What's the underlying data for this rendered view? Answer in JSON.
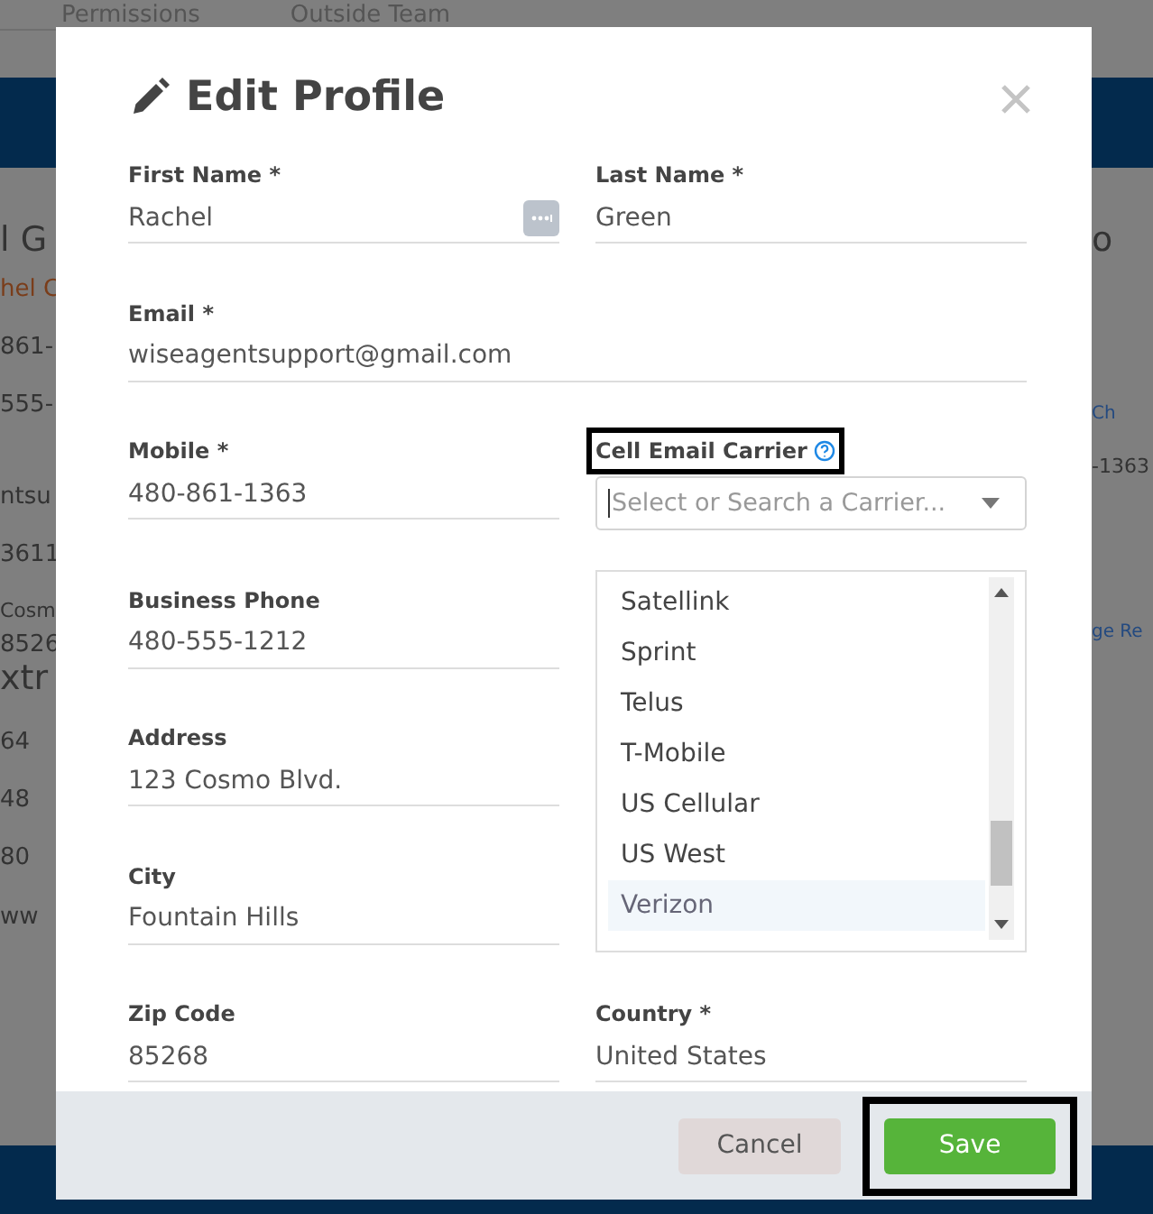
{
  "background": {
    "tabs": [
      {
        "label": "Permissions"
      },
      {
        "label": "Outside Team"
      }
    ],
    "left_fragments": [
      {
        "text": "l G",
        "kind": "heading"
      },
      {
        "text": "hel C",
        "kind": "accent"
      },
      {
        "text": "861-",
        "kind": "text"
      },
      {
        "text": "555-",
        "kind": "text"
      },
      {
        "text": "ntsu",
        "kind": "gap"
      },
      {
        "text": "3611",
        "kind": "text"
      },
      {
        "text": "Cosm",
        "kind": "small"
      },
      {
        "text": "8526",
        "kind": "tight"
      },
      {
        "text": "xtr",
        "kind": "heading"
      },
      {
        "text": "64",
        "kind": "text"
      },
      {
        "text": "48",
        "kind": "text"
      },
      {
        "text": "80",
        "kind": "text"
      },
      {
        "text": "ww",
        "kind": "text"
      }
    ],
    "right_fragments": [
      {
        "text": "o",
        "kind": "heading"
      },
      {
        "text": "Ch",
        "kind": "link"
      },
      {
        "text": "-1363",
        "kind": "small"
      },
      {
        "text": "ge Re",
        "kind": "link"
      }
    ]
  },
  "dialog": {
    "title": "Edit Profile",
    "fields": [
      {
        "kind": "text",
        "label": "First Name *",
        "value": "Rachel",
        "autofill_icon": true
      },
      {
        "kind": "text",
        "label": "Last Name *",
        "value": "Green"
      },
      {
        "kind": "wide",
        "label": "Email *",
        "value": "wiseagentsupport@gmail.com"
      },
      {
        "kind": "text",
        "label": "Mobile *",
        "value": "480-861-1363"
      },
      {
        "kind": "select",
        "label": "Cell Email Carrier",
        "highlighted": true,
        "placeholder": "Select or Search a Carrier...",
        "expanded": true,
        "options": [
          {
            "label": "Satellink",
            "selected": false
          },
          {
            "label": "Sprint",
            "selected": false
          },
          {
            "label": "Telus",
            "selected": false
          },
          {
            "label": "T-Mobile",
            "selected": false
          },
          {
            "label": "US Cellular",
            "selected": false
          },
          {
            "label": "US West",
            "selected": false
          },
          {
            "label": "Verizon",
            "selected": true
          }
        ]
      },
      {
        "kind": "text",
        "label": "Business Phone",
        "value": "480-555-1212"
      },
      {
        "kind": "blank"
      },
      {
        "kind": "text",
        "label": "Address",
        "value": "123 Cosmo Blvd."
      },
      {
        "kind": "blank"
      },
      {
        "kind": "text",
        "label": "City",
        "value": "Fountain Hills"
      },
      {
        "kind": "blank"
      },
      {
        "kind": "text",
        "label": "Zip Code",
        "value": "85268"
      },
      {
        "kind": "text",
        "label": "Country *",
        "value": "United States"
      }
    ],
    "buttons": [
      {
        "label": "Cancel",
        "kind": "secondary",
        "highlighted": false
      },
      {
        "label": "Save",
        "kind": "primary",
        "highlighted": true
      }
    ]
  }
}
